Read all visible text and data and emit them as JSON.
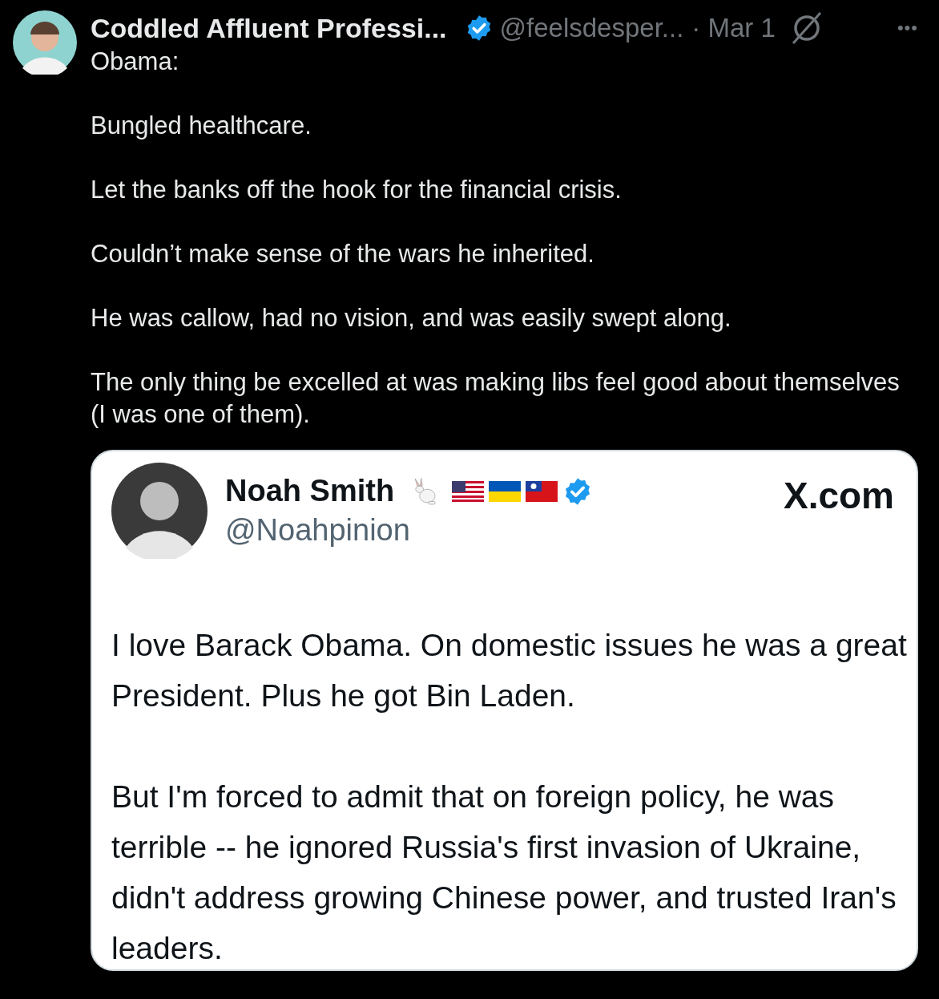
{
  "post": {
    "author": {
      "name": "Coddled Affluent Professi...",
      "verified": true,
      "handle": "@feelsdesper...",
      "date": "· Mar 1"
    },
    "more": "•••",
    "paragraphs": [
      "Obama:",
      "Bungled healthcare.",
      "Let the banks off the hook for the financial crisis.",
      "Couldn’t make sense of the wars he inherited.",
      "He was callow, had no vision, and was easily swept along.",
      "The only thing be excelled at was making libs feel good about themselves (I was one of them)."
    ]
  },
  "quoted": {
    "author": {
      "name": "Noah Smith",
      "verified": true,
      "handle": "@Noahpinion"
    },
    "source": "X.com",
    "paragraphs": [
      "I love Barack Obama. On domestic issues he was a great President. Plus he got Bin Laden.",
      "But I'm forced to admit that on foreign policy, he was terrible -- he ignored Russia's first invasion of Ukraine, didn't address growing Chinese power, and trusted Iran's leaders."
    ]
  }
}
